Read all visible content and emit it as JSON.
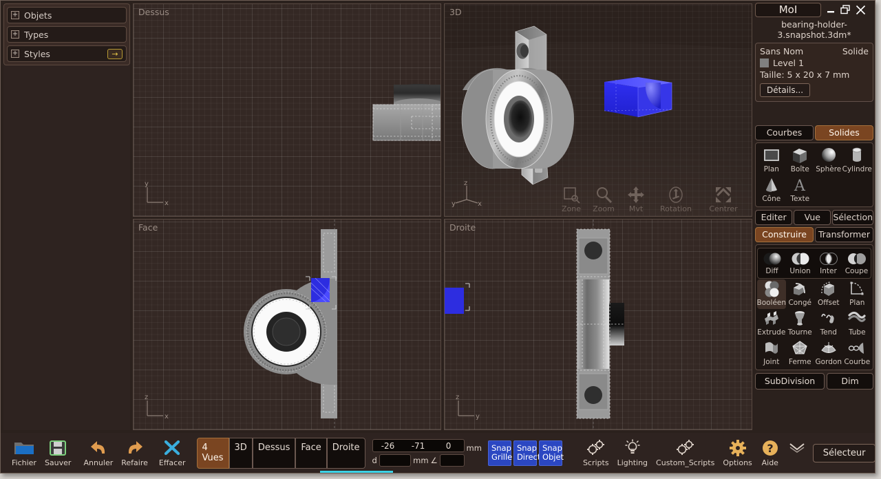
{
  "app": {
    "logo": "MoI",
    "file_name": "bearing-holder-3.snapshot.3dm*",
    "window_controls": {
      "minimize": "minimize-icon",
      "restore": "restore-icon",
      "close": "close-icon"
    }
  },
  "sidebar": {
    "items": [
      {
        "label": "Objets",
        "expand": "+"
      },
      {
        "label": "Types",
        "expand": "+"
      },
      {
        "label": "Styles",
        "expand": "+",
        "arrow": "→"
      }
    ]
  },
  "viewports": [
    {
      "name": "dessus",
      "label": "Dessus",
      "axes": [
        "y",
        "x"
      ]
    },
    {
      "name": "3d",
      "label": "3D",
      "axes": [
        "z",
        "y",
        "x"
      ]
    },
    {
      "name": "face",
      "label": "Face",
      "axes": [
        "z",
        "x"
      ]
    },
    {
      "name": "droite",
      "label": "Droite",
      "axes": [
        "z",
        "y"
      ]
    }
  ],
  "viewport_nav": [
    {
      "label": "Zone",
      "icon": "zone-select-icon"
    },
    {
      "label": "Zoom",
      "icon": "magnifier-icon"
    },
    {
      "label": "Mvt",
      "icon": "pan-arrows-icon"
    },
    {
      "label": "Rotation",
      "icon": "rotate-icon"
    },
    {
      "label": "Centrer",
      "icon": "expand-arrows-icon"
    }
  ],
  "object_panel": {
    "name": "Sans Nom",
    "type": "Solide",
    "level": "Level 1",
    "size": "Taille: 5 x 20 x 7 mm",
    "details_button": "Détails..."
  },
  "geometry_tabs": {
    "curves": "Courbes",
    "solids": "Solides",
    "active": "Solides"
  },
  "primitives": [
    {
      "label": "Plan",
      "icon": "plane-icon"
    },
    {
      "label": "Boîte",
      "icon": "box-icon"
    },
    {
      "label": "Sphère",
      "icon": "sphere-icon"
    },
    {
      "label": "Cylindre",
      "icon": "cylinder-icon"
    },
    {
      "label": "Cône",
      "icon": "cone-icon"
    },
    {
      "label": "Texte",
      "icon": "text-icon"
    }
  ],
  "menu_tabs": [
    {
      "label": "Editer"
    },
    {
      "label": "Vue"
    },
    {
      "label": "Sélection"
    }
  ],
  "mode_tabs": {
    "build": "Construire",
    "transform": "Transformer",
    "active": "Construire"
  },
  "boolean_flyout": [
    {
      "label": "Diff",
      "icon": "boolean-difference-icon"
    },
    {
      "label": "Union",
      "icon": "boolean-union-icon"
    },
    {
      "label": "Inter",
      "icon": "boolean-intersect-icon"
    },
    {
      "label": "Coupe",
      "icon": "boolean-cut-icon"
    }
  ],
  "construct_tools": [
    {
      "label": "Booléen",
      "icon": "boolean-icon",
      "highlighted": true
    },
    {
      "label": "Congé",
      "icon": "fillet-icon"
    },
    {
      "label": "Offset",
      "icon": "offset-icon"
    },
    {
      "label": "Plan",
      "icon": "planar-icon"
    },
    {
      "label": "Extrude",
      "icon": "extrude-icon"
    },
    {
      "label": "Tourne",
      "icon": "revolve-icon"
    },
    {
      "label": "Tend",
      "icon": "sweep-icon"
    },
    {
      "label": "Tube",
      "icon": "pipe-icon"
    },
    {
      "label": "Joint",
      "icon": "loft-icon"
    },
    {
      "label": "Ferme",
      "icon": "network-icon"
    },
    {
      "label": "Gordon",
      "icon": "gordon-icon"
    },
    {
      "label": "Courbe",
      "icon": "blend-curve-icon"
    }
  ],
  "bottom_panel_buttons": [
    {
      "label": "SubDivision"
    },
    {
      "label": "Dim"
    }
  ],
  "bottom_bar": {
    "file_tools": [
      {
        "label": "Fichier",
        "icon": "folder-icon"
      },
      {
        "label": "Sauver",
        "icon": "floppy-disk-icon"
      },
      {
        "label": "Annuler",
        "icon": "undo-arrow-icon"
      },
      {
        "label": "Refaire",
        "icon": "redo-arrow-icon"
      },
      {
        "label": "Effacer",
        "icon": "delete-x-icon"
      }
    ],
    "view_tabs": [
      {
        "label": "4 Vues",
        "active": true
      },
      {
        "label": "3D",
        "active": false
      },
      {
        "label": "Dessus",
        "active": false
      },
      {
        "label": "Face",
        "active": false
      },
      {
        "label": "Droite",
        "active": false
      }
    ],
    "coordinates": {
      "x": "-26",
      "y": "-71",
      "z": "0",
      "unit": "mm",
      "distance_label": "d",
      "distance_value": "",
      "distance_unit": "mm",
      "angle_symbol": "∠",
      "angle_value": ""
    },
    "snap_buttons": [
      {
        "line1": "Snap",
        "line2": "Grille"
      },
      {
        "line1": "Snap",
        "line2": "Direct"
      },
      {
        "line1": "Snap",
        "line2": "Objet"
      }
    ],
    "script_tools": [
      {
        "label": "Scripts",
        "icon": "gears-icon"
      },
      {
        "label": "Lighting",
        "icon": "lightbulb-icon"
      },
      {
        "label": "Custom_Scripts",
        "icon": "gears-icon"
      }
    ],
    "right_tools": [
      {
        "label": "Options",
        "icon": "gear-icon"
      },
      {
        "label": "Aide",
        "icon": "help-question-icon"
      }
    ],
    "chevron": "chevron-down-icon",
    "selector_button": "Sélecteur"
  },
  "colors": {
    "accent_brown": "#7a4521",
    "panel_bg": "#2e2320",
    "viewport_bg": "#342824",
    "selection_blue": "#2d2de0",
    "snap_blue": "#2b47c2",
    "arrow_yellow": "#e9c84a"
  }
}
